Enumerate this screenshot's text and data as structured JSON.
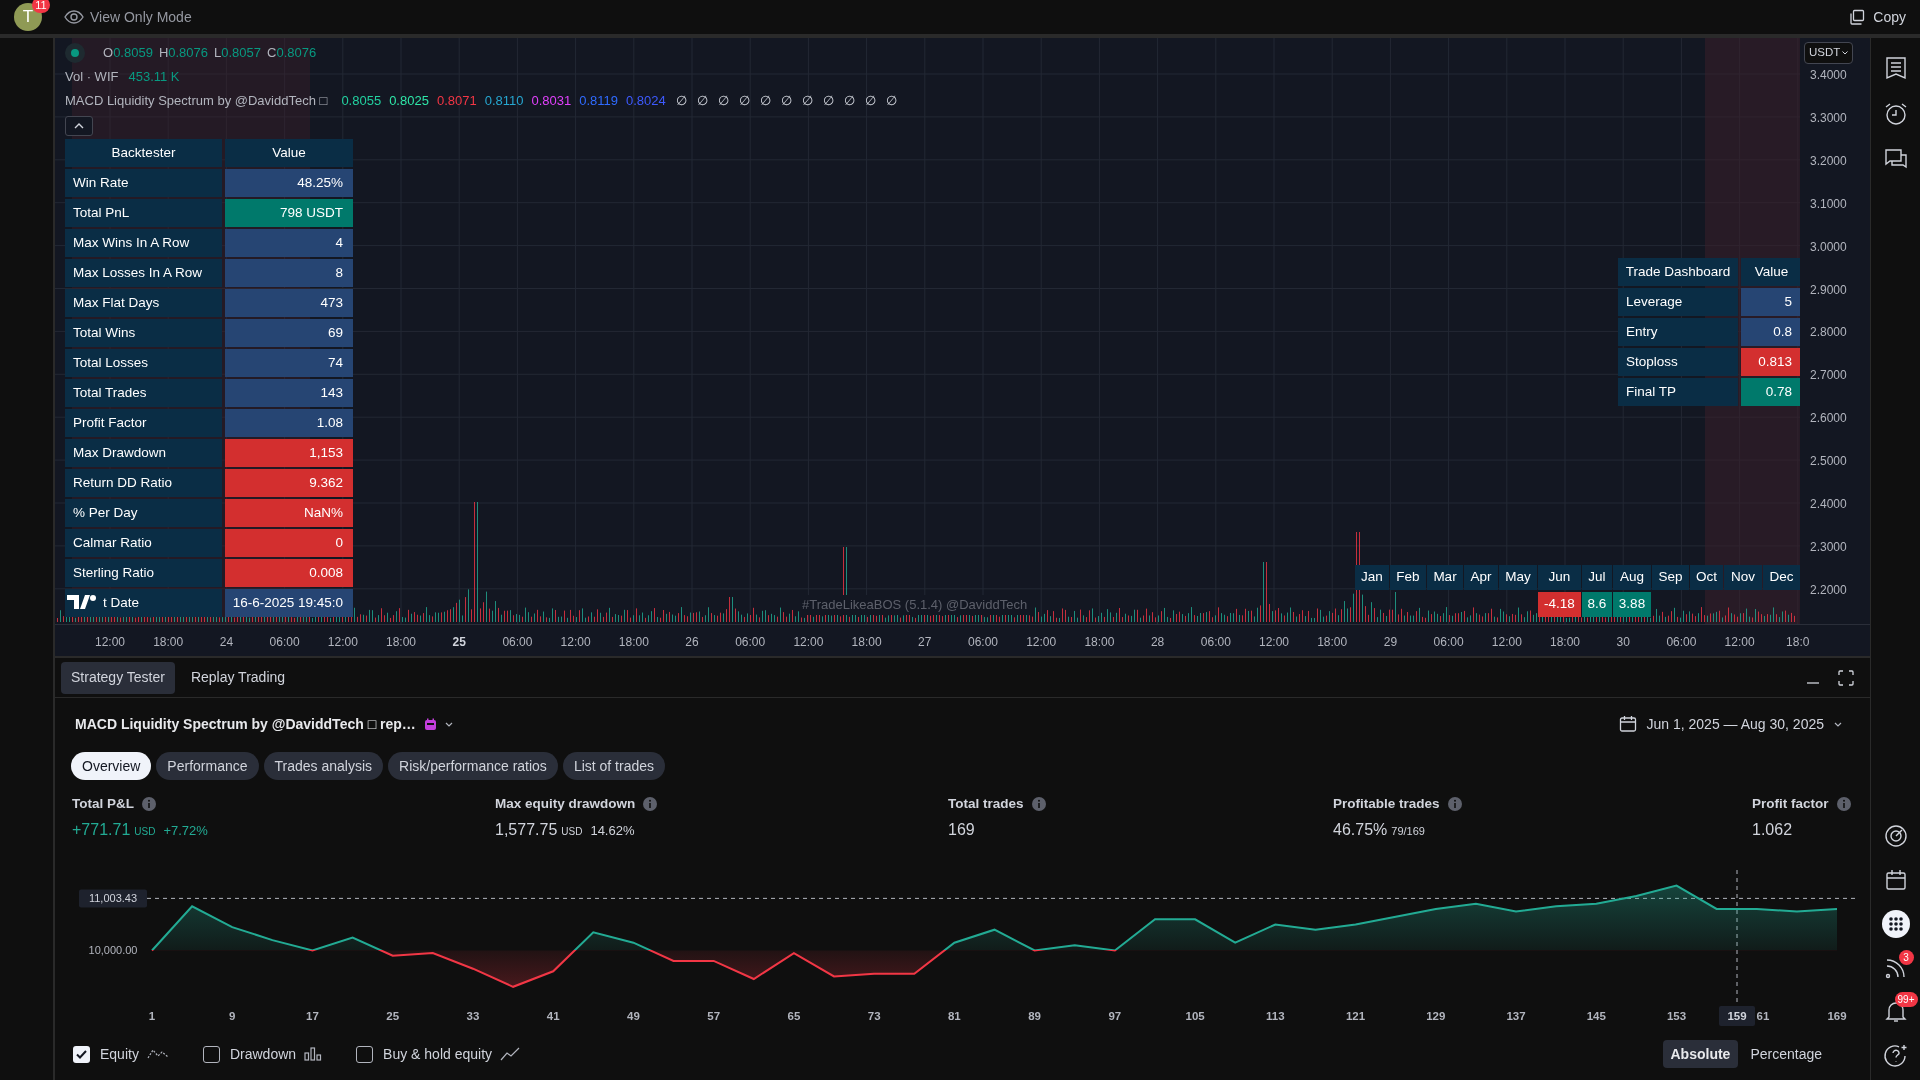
{
  "top_bar": {
    "avatar": "T",
    "notification_count": "11",
    "mode": "View Only Mode",
    "copy": "Copy"
  },
  "legend": {
    "ohlc": [
      {
        "label": "O",
        "value": "0.8059"
      },
      {
        "label": "H",
        "value": "0.8076"
      },
      {
        "label": "L",
        "value": "0.8057"
      },
      {
        "label": "C",
        "value": "0.8076"
      }
    ],
    "volume": {
      "label": "Vol · WIF",
      "value": "453.11 K"
    },
    "indicator": {
      "name": "MACD Liquidity Spectrum by @DaviddTech □",
      "values": [
        {
          "text": "0.8055",
          "color": "#22d1a0"
        },
        {
          "text": "0.8025",
          "color": "#2ee6a8"
        },
        {
          "text": "0.8071",
          "color": "#f23645"
        },
        {
          "text": "0.8110",
          "color": "#26a6d0"
        },
        {
          "text": "0.8031",
          "color": "#e040fb"
        },
        {
          "text": "0.8119",
          "color": "#2f6bff"
        },
        {
          "text": "0.8024",
          "color": "#3d5afe"
        }
      ],
      "empty_values": [
        "∅",
        "∅",
        "∅",
        "∅",
        "∅",
        "∅",
        "∅",
        "∅",
        "∅",
        "∅",
        "∅"
      ]
    }
  },
  "backtester": {
    "columns": [
      "Backtester",
      "Value"
    ],
    "rows": [
      {
        "label": "Win Rate",
        "value": "48.25%",
        "color": "#264573"
      },
      {
        "label": "Total PnL",
        "value": "798 USDT",
        "color": "#00796b"
      },
      {
        "label": "Max Wins In A Row",
        "value": "4",
        "color": "#264573"
      },
      {
        "label": "Max Losses In A Row",
        "value": "8",
        "color": "#264573"
      },
      {
        "label": "Max Flat Days",
        "value": "473",
        "color": "#264573"
      },
      {
        "label": "Total Wins",
        "value": "69",
        "color": "#264573"
      },
      {
        "label": "Total Losses",
        "value": "74",
        "color": "#264573"
      },
      {
        "label": "Total Trades",
        "value": "143",
        "color": "#264573"
      },
      {
        "label": "Profit Factor",
        "value": "1.08",
        "color": "#264573"
      },
      {
        "label": "Max Drawdown",
        "value": "1,153",
        "color": "#d32f2f"
      },
      {
        "label": "Return DD Ratio",
        "value": "9.362",
        "color": "#d32f2f"
      },
      {
        "label": "% Per Day",
        "value": "NaN%",
        "color": "#d32f2f"
      },
      {
        "label": "Calmar Ratio",
        "value": "0",
        "color": "#d32f2f"
      },
      {
        "label": "Sterling Ratio",
        "value": "0.008",
        "color": "#d32f2f"
      },
      {
        "label": "t Date",
        "value": "16-6-2025 19:45:0",
        "color": "#264573"
      }
    ]
  },
  "trade_dashboard": {
    "columns": [
      "Trade Dashboard",
      "Value"
    ],
    "rows": [
      {
        "label": "Leverage",
        "value": "5",
        "color": "#264573"
      },
      {
        "label": "Entry",
        "value": "0.8",
        "color": "#264573"
      },
      {
        "label": "Stoploss",
        "value": "0.813",
        "color": "#d32f2f"
      },
      {
        "label": "Final TP",
        "value": "0.78",
        "color": "#00796b"
      }
    ]
  },
  "monthly_returns": [
    {
      "month": "Jan"
    },
    {
      "month": "Feb"
    },
    {
      "month": "Mar"
    },
    {
      "month": "Apr"
    },
    {
      "month": "May"
    },
    {
      "month": "Jun",
      "value": "-4.18",
      "color": "#d32f2f"
    },
    {
      "month": "Jul",
      "value": "8.6",
      "color": "#00796b"
    },
    {
      "month": "Aug",
      "value": "3.88",
      "color": "#00796b"
    },
    {
      "month": "Sep"
    },
    {
      "month": "Oct"
    },
    {
      "month": "Nov"
    },
    {
      "month": "Dec"
    }
  ],
  "chart_caption": "#TradeLikeaBOS (5.1.4) @DaviddTech",
  "currency_button": "USDT",
  "price_axis": [
    "3.4000",
    "3.3000",
    "3.2000",
    "3.1000",
    "3.0000",
    "2.9000",
    "2.8000",
    "2.7000",
    "2.6000",
    "2.5000",
    "2.4000",
    "2.3000",
    "2.2000"
  ],
  "time_axis": [
    {
      "text": "12:00",
      "bold": false
    },
    {
      "text": "18:00",
      "bold": false
    },
    {
      "text": "24",
      "bold": false
    },
    {
      "text": "06:00",
      "bold": false
    },
    {
      "text": "12:00",
      "bold": false
    },
    {
      "text": "18:00",
      "bold": false
    },
    {
      "text": "25",
      "bold": true
    },
    {
      "text": "06:00",
      "bold": false
    },
    {
      "text": "12:00",
      "bold": false
    },
    {
      "text": "18:00",
      "bold": false
    },
    {
      "text": "26",
      "bold": false
    },
    {
      "text": "06:00",
      "bold": false
    },
    {
      "text": "12:00",
      "bold": false
    },
    {
      "text": "18:00",
      "bold": false
    },
    {
      "text": "27",
      "bold": false
    },
    {
      "text": "06:00",
      "bold": false
    },
    {
      "text": "12:00",
      "bold": false
    },
    {
      "text": "18:00",
      "bold": false
    },
    {
      "text": "28",
      "bold": false
    },
    {
      "text": "06:00",
      "bold": false
    },
    {
      "text": "12:00",
      "bold": false
    },
    {
      "text": "18:00",
      "bold": false
    },
    {
      "text": "29",
      "bold": false
    },
    {
      "text": "06:00",
      "bold": false
    },
    {
      "text": "12:00",
      "bold": false
    },
    {
      "text": "18:00",
      "bold": false
    },
    {
      "text": "30",
      "bold": false
    },
    {
      "text": "06:00",
      "bold": false
    },
    {
      "text": "12:00",
      "bold": false
    },
    {
      "text": "18:0",
      "bold": false
    }
  ],
  "panel": {
    "tabs": [
      {
        "label": "Strategy Tester",
        "selected": true
      },
      {
        "label": "Replay Trading",
        "selected": false
      }
    ],
    "strategy": "MACD Liquidity Spectrum by @DaviddTech □ rep…",
    "date_range": "Jun 1, 2025 — Aug 30, 2025",
    "subtabs": [
      {
        "label": "Overview",
        "selected": true
      },
      {
        "label": "Performance",
        "selected": false
      },
      {
        "label": "Trades analysis",
        "selected": false
      },
      {
        "label": "Risk/performance ratios",
        "selected": false
      },
      {
        "label": "List of trades",
        "selected": false
      }
    ],
    "metrics": [
      {
        "label": "Total P&L",
        "value": "+771.71",
        "unit": "USD",
        "extra": "+7.72%",
        "positive": true
      },
      {
        "label": "Max equity drawdown",
        "value": "1,577.75",
        "unit": "USD",
        "extra": "14.62%",
        "positive": false
      },
      {
        "label": "Total trades",
        "value": "169",
        "positive": false
      },
      {
        "label": "Profitable trades",
        "value": "46.75%",
        "extra": "79/169",
        "positive": false
      },
      {
        "label": "Profit factor",
        "value": "1.062",
        "positive": false
      }
    ],
    "chart_data": {
      "type": "area",
      "xlim": [
        1,
        169
      ],
      "ylim": [
        8950,
        11550
      ],
      "x": [
        1,
        5,
        9,
        13,
        17,
        21,
        25,
        29,
        33,
        37,
        41,
        45,
        49,
        53,
        57,
        61,
        65,
        69,
        73,
        77,
        81,
        85,
        89,
        93,
        97,
        101,
        105,
        109,
        113,
        117,
        121,
        125,
        129,
        133,
        137,
        141,
        145,
        149,
        153,
        157,
        161,
        165,
        169
      ],
      "series": [
        {
          "name": "Equity",
          "color": "#22ab94",
          "values": [
            10000,
            10850,
            10450,
            10200,
            10000,
            10250,
            9900,
            9950,
            9650,
            9300,
            9600,
            10350,
            10150,
            9800,
            9800,
            9450,
            9950,
            9500,
            9550,
            9550,
            10150,
            10400,
            10000,
            10100,
            10000,
            10600,
            10600,
            10150,
            10500,
            10400,
            10500,
            10650,
            10800,
            10900,
            10750,
            10850,
            10900,
            11050,
            11250,
            10800,
            10800,
            10750,
            10800
          ]
        }
      ],
      "xticks": [
        1,
        9,
        17,
        25,
        33,
        41,
        49,
        57,
        65,
        73,
        81,
        89,
        97,
        105,
        113,
        121,
        129,
        137,
        145,
        153,
        169
      ],
      "yticks": [
        {
          "value": 10000,
          "label": "10,000.00"
        },
        {
          "value": 11003.43,
          "label": "11,003.43"
        }
      ]
    },
    "crosshair_label": "159",
    "covered_tick": "61",
    "legend_options": [
      {
        "checked": true,
        "kind": "line"
      },
      {
        "label": "Drawdown",
        "checked": false,
        "kind": "bars"
      },
      {
        "label": "Buy & hold equity",
        "checked": false,
        "kind": "trend"
      }
    ],
    "scale_modes": [
      {
        "label": "Absolute",
        "selected": true
      },
      {
        "label": "Percentage",
        "selected": false
      }
    ]
  },
  "sidebar": {
    "feed_badge": "3",
    "alerts_badge": "99+"
  }
}
